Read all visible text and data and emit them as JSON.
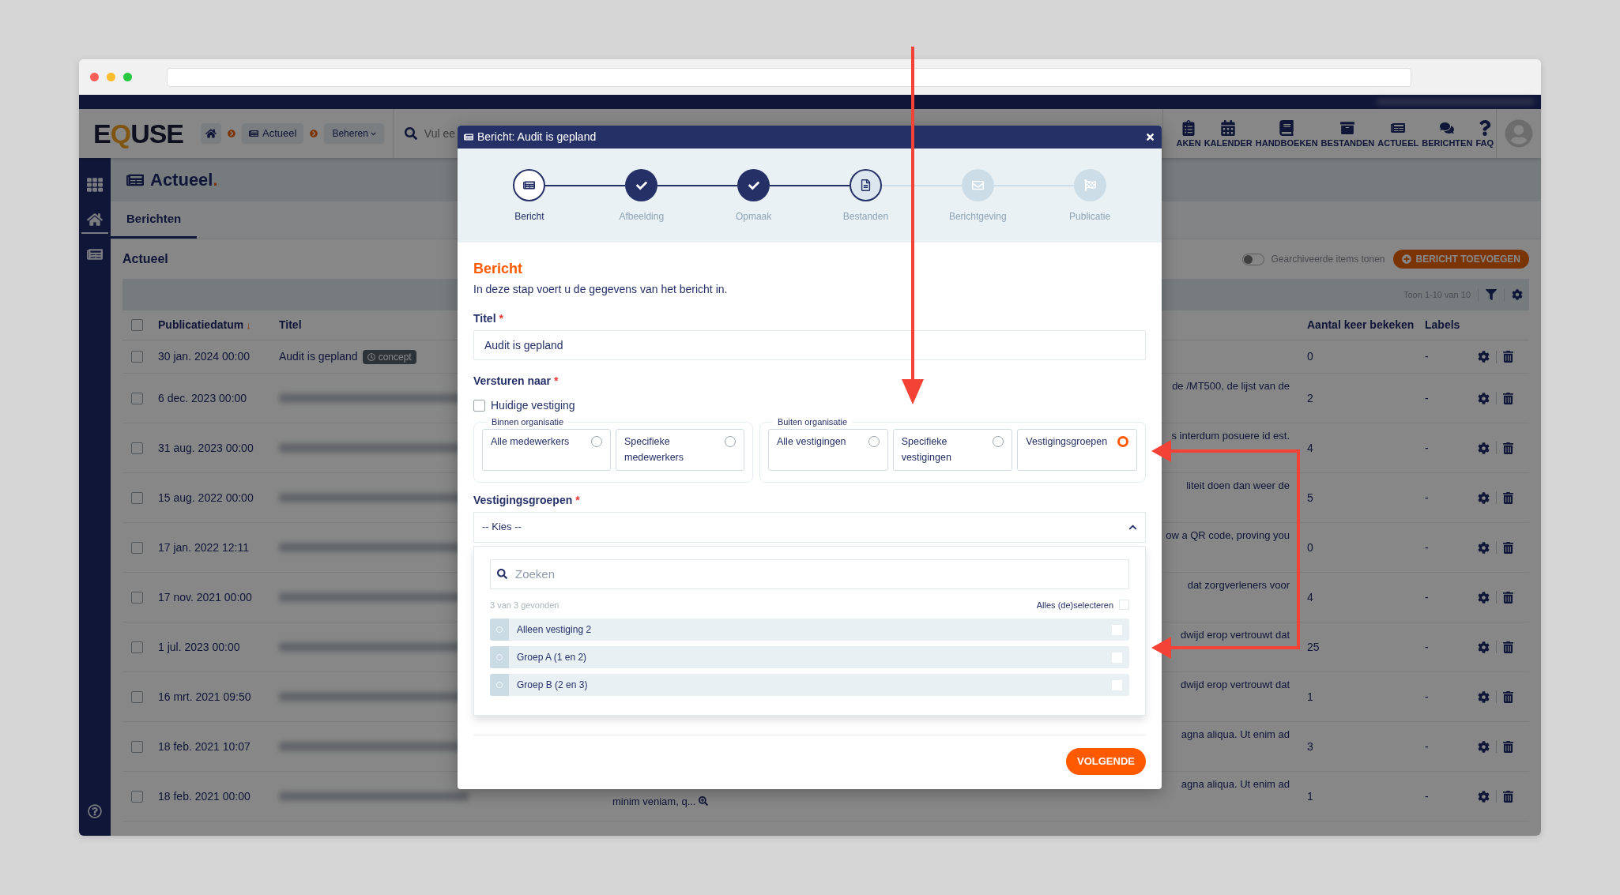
{
  "header": {
    "logo": {
      "before": "E",
      "accent": "Q",
      "after": "USE"
    },
    "breadcrumb": [
      {
        "kind": "home"
      },
      {
        "kind": "link",
        "label": "Actueel"
      },
      {
        "kind": "menu",
        "label": "Beheren"
      }
    ],
    "search": {
      "placeholder": "Vul ee"
    },
    "nav": [
      {
        "kind": "clipboard",
        "label": "AKEN"
      },
      {
        "kind": "calendar",
        "label": "KALENDER"
      },
      {
        "kind": "book",
        "label": "HANDBOEKEN"
      },
      {
        "kind": "archive",
        "label": "BESTANDEN"
      },
      {
        "kind": "news",
        "label": "ACTUEEL"
      },
      {
        "kind": "chat",
        "label": "BERICHTEN"
      },
      {
        "kind": "question",
        "label": "FAQ"
      }
    ]
  },
  "sidebar": {
    "items": [
      {
        "kind": "apps",
        "selected": false
      },
      {
        "kind": "home",
        "selected": true
      },
      {
        "kind": "news",
        "selected": false
      }
    ]
  },
  "page": {
    "title": "Actueel",
    "title_mark": "."
  },
  "tabs": [
    {
      "label": "Berichten",
      "selected": true
    }
  ],
  "section_title": "Actueel",
  "archived_toggle": {
    "label": "Gearchiveerde items tonen",
    "on": false
  },
  "add_button": "BERICHT TOEVOEGEN",
  "pager": "Toon 1-10 van 10",
  "table": {
    "select_all_checked": false,
    "columns": [
      {
        "label": "Publicatiedatum",
        "sort_mark": "↓"
      },
      {
        "label": "Titel"
      },
      {
        "label": "Aantal keer bekeken"
      },
      {
        "label": "Labels"
      }
    ],
    "rows": [
      {
        "checked": false,
        "date": "30 jan. 2024 00:00",
        "blurred": false,
        "title": "Audit is gepland",
        "badge": "concept",
        "views": "0",
        "labels": "-"
      },
      {
        "checked": false,
        "date": "6 dec. 2023 00:00",
        "blurred": true,
        "description": "de /MT500, de lijst van de",
        "views": "2",
        "labels": "-"
      },
      {
        "checked": false,
        "date": "31 aug. 2023 00:00",
        "blurred": true,
        "description": "s interdum posuere id est.",
        "views": "4",
        "labels": "-"
      },
      {
        "checked": false,
        "date": "15 aug. 2022 00:00",
        "blurred": true,
        "description": "liteit doen dan weer de",
        "views": "5",
        "labels": "-"
      },
      {
        "checked": false,
        "date": "17 jan. 2022 12:11",
        "blurred": true,
        "description": "ow a QR code, proving you",
        "views": "0",
        "labels": "-"
      },
      {
        "checked": false,
        "date": "17 nov. 2021 00:00",
        "blurred": true,
        "description": "dat zorgverleners voor",
        "views": "4",
        "labels": "-"
      },
      {
        "checked": false,
        "date": "1 jul. 2023 00:00",
        "blurred": true,
        "description": "dwijd erop vertrouwt dat",
        "views": "25",
        "labels": "-"
      },
      {
        "checked": false,
        "date": "16 mrt. 2021 09:50",
        "blurred": true,
        "description": "dwijd erop vertrouwt dat",
        "views": "1",
        "labels": "-"
      },
      {
        "checked": false,
        "date": "18 feb. 2021 10:07",
        "blurred": true,
        "description": "agna aliqua. Ut enim ad",
        "views": "3",
        "labels": "-"
      },
      {
        "checked": false,
        "date": "18 feb. 2021 00:00",
        "blurred": true,
        "description": "agna aliqua. Ut enim ad",
        "description_more": "minim veniam, q...",
        "views": "1",
        "labels": "-"
      }
    ]
  },
  "modal": {
    "title": "Bericht: Audit is gepland",
    "steps": [
      {
        "kind": "news",
        "label": "Bericht",
        "selected": true,
        "done": false,
        "disabled": false
      },
      {
        "kind": "image",
        "label": "Afbeelding",
        "selected": false,
        "done": true,
        "disabled": false
      },
      {
        "kind": "layout",
        "label": "Opmaak",
        "selected": false,
        "done": true,
        "disabled": false
      },
      {
        "kind": "file",
        "label": "Bestanden",
        "selected": false,
        "done": false,
        "disabled": false
      },
      {
        "kind": "mail",
        "label": "Berichtgeving",
        "selected": false,
        "done": false,
        "disabled": true
      },
      {
        "kind": "flag",
        "label": "Publicatie",
        "selected": false,
        "done": false,
        "disabled": true
      }
    ],
    "heading": "Bericht",
    "intro": "In deze stap voert u de gegevens van het bericht in.",
    "title_field": {
      "label": "Titel",
      "required_mark": "*",
      "value": "Audit is gepland"
    },
    "recipients": {
      "label": "Versturen naar",
      "required_mark": "*",
      "current_location": {
        "label": "Huidige vestiging",
        "checked": false
      },
      "groups": [
        {
          "legend": "Binnen organisatie",
          "options": [
            {
              "label": "Alle medewerkers",
              "selected": false
            },
            {
              "label": "Specifieke medewerkers",
              "selected": false
            }
          ]
        },
        {
          "legend": "Buiten organisatie",
          "options": [
            {
              "label": "Alle vestigingen",
              "selected": false
            },
            {
              "label": "Specifieke vestigingen",
              "selected": false
            },
            {
              "label": "Vestigingsgroepen",
              "selected": true
            }
          ]
        }
      ]
    },
    "group_select": {
      "label": "Vestigingsgroepen",
      "required_mark": "*",
      "value": "-- Kies --",
      "expanded": true,
      "search_placeholder": "Zoeken",
      "count": "3 van 3 gevonden",
      "select_all": {
        "label": "Alles (de)selecteren",
        "checked": false
      },
      "options": [
        {
          "label": "Alleen vestiging 2",
          "checked": false
        },
        {
          "label": "Groep A (1 en 2)",
          "checked": false
        },
        {
          "label": "Groep B (2 en 3)",
          "checked": false
        }
      ]
    },
    "next_button": "VOLGENDE"
  }
}
